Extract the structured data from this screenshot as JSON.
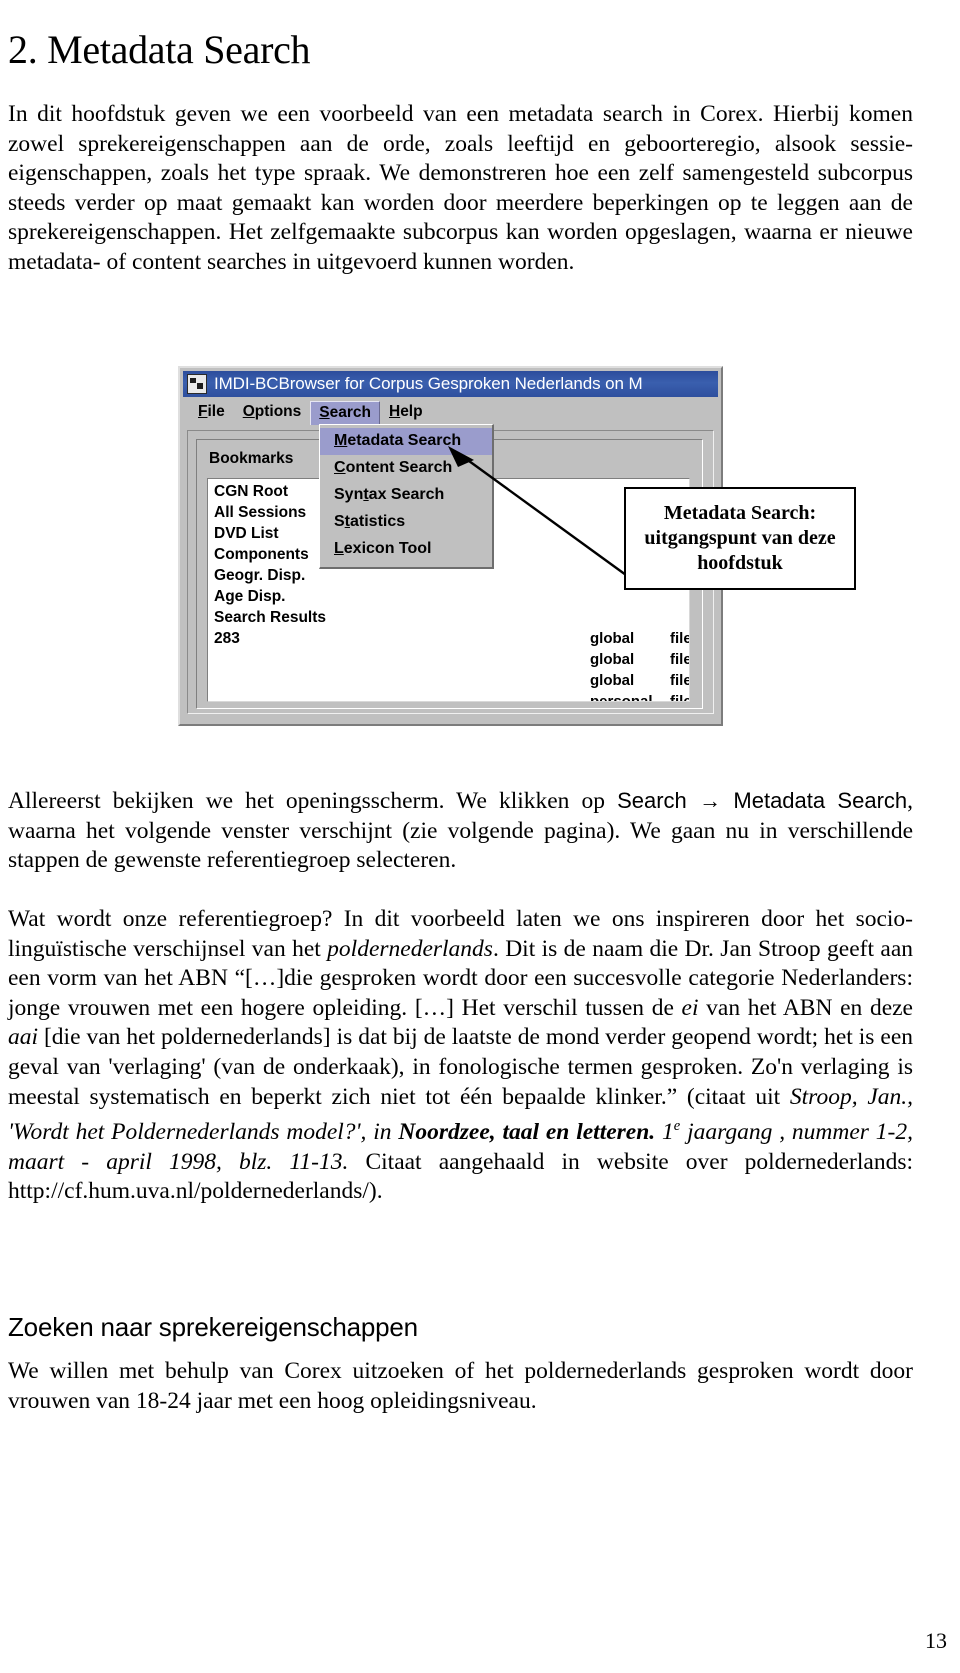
{
  "document": {
    "chapter_title": "2. Metadata Search",
    "page_number": "13",
    "sub_heading": "Zoeken naar sprekereigenschappen"
  },
  "paragraphs": {
    "intro_1": "In dit hoofdstuk geven we een voorbeeld van een metadata search in Corex. Hierbij komen zowel sprekereigenschappen aan de orde, zoals leeftijd en geboorteregio, alsook sessie-eigenschappen, zoals het type spraak. We demonstreren hoe een zelf samengesteld subcorpus steeds verder op maat gemaakt kan worden door meerdere beperkingen op te leggen aan de sprekereigenschappen. Het zelfgemaakte subcorpus kan worden opgeslagen, waarna er nieuwe metadata- of content searches in uitgevoerd kunnen worden.",
    "after_shot_a": "Allereerst bekijken we het openingsscherm. We klikken op ",
    "after_shot_menu_search": "Search",
    "after_shot_arrow": " → ",
    "after_shot_menu_metadata": "Metadata Search",
    "after_shot_b": ", waarna het volgende venster verschijnt (zie volgende pagina). We gaan nu in verschillende stappen de gewenste referentiegroep selecteren.",
    "quote_a": "Wat wordt onze referentiegroep? In dit voorbeeld laten we ons inspireren door het socio-linguïstische verschijnsel van het ",
    "quote_term_1": "poldernederlands",
    "quote_b": ". Dit is de naam die Dr. Jan Stroop geeft aan een vorm van het ABN “[…]die gesproken wordt door een succesvolle categorie Nederlanders: jonge vrouwen met een hogere opleiding. […] Het verschil tussen de ",
    "quote_term_2": "ei",
    "quote_c": " van het ABN en deze ",
    "quote_term_3": "aai",
    "quote_d": " [die van het poldernederlands] is dat bij de laatste de mond verder geopend wordt; het is een geval van 'verlaging' (van de onderkaak), in fonologische termen gesproken. Zo'n verlaging is meestal systematisch en beperkt zich niet tot één bepaalde klinker.” (citaat uit ",
    "citation_author": "Stroop, Jan., 'Wordt het Poldernederlands model?',",
    "citation_in": " in ",
    "citation_work": "Noordzee, taal en letteren.",
    "citation_volume_num": " 1",
    "citation_volume_sup": "e",
    "citation_volume_rest": " jaargang , nummer 1-2, maart - april 1998, blz. 11-13.",
    "citation_tail": " Citaat aangehaald in website over poldernederlands: http://cf.hum.uva.nl/poldernederlands/).",
    "closing": "We willen met behulp van Corex uitzoeken of het poldernederlands gesproken wordt door vrouwen van 18-24 jaar met een hoog opleidingsniveau."
  },
  "screenshot": {
    "window_title": "IMDI-BCBrowser for Corpus Gesproken Nederlands on M",
    "menubar": [
      {
        "label": "File",
        "mnemonic": "F",
        "active": false
      },
      {
        "label": "Options",
        "mnemonic": "O",
        "active": false
      },
      {
        "label": "Search",
        "mnemonic": "S",
        "active": true
      },
      {
        "label": "Help",
        "mnemonic": "H",
        "active": false
      }
    ],
    "search_menu": [
      {
        "label": "Metadata Search",
        "mnemonic": "M",
        "selected": true
      },
      {
        "label": "Content Search",
        "mnemonic": "C",
        "selected": false
      },
      {
        "label": "Syntax Search",
        "mnemonic": "t",
        "selected": false
      },
      {
        "label": "Statistics",
        "mnemonic": "t",
        "selected": false
      },
      {
        "label": "Lexicon Tool",
        "mnemonic": "L",
        "selected": false
      }
    ],
    "tab_label": "Bookmarks",
    "tree_items": [
      "CGN Root",
      "All Sessions",
      "DVD List",
      "Components",
      "Geogr. Disp.",
      "Age Disp.",
      "Search Results",
      "283"
    ],
    "attribute_rows": [
      {
        "scope": "global",
        "type": "file"
      },
      {
        "scope": "global",
        "type": "file"
      },
      {
        "scope": "global",
        "type": "file"
      },
      {
        "scope": "personal",
        "type": "file"
      }
    ],
    "callout": "Metadata Search: uitgangspunt van deze hoofdstuk",
    "colors": {
      "titlebar": "#31539f",
      "menu_highlight": "#9a9ccc",
      "window_face": "#c0c0c0",
      "list_background": "#ffffff"
    }
  }
}
